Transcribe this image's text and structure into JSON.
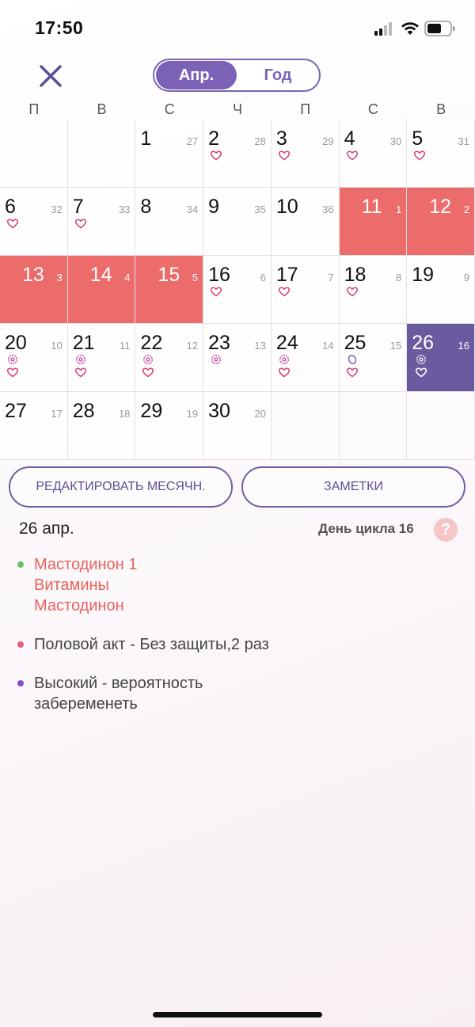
{
  "status": {
    "time": "17:50"
  },
  "header": {
    "close_icon": "close-icon",
    "segments": [
      {
        "label": "Апр.",
        "selected": true
      },
      {
        "label": "Год",
        "selected": false
      }
    ]
  },
  "weekdays": [
    "П",
    "В",
    "С",
    "Ч",
    "П",
    "С",
    "В"
  ],
  "calendar": {
    "rows": [
      [
        null,
        null,
        {
          "day": "1",
          "cycle": "27",
          "icons": []
        },
        {
          "day": "2",
          "cycle": "28",
          "icons": [
            "heart"
          ]
        },
        {
          "day": "3",
          "cycle": "29",
          "icons": [
            "heart"
          ]
        },
        {
          "day": "4",
          "cycle": "30",
          "icons": [
            "heart"
          ]
        },
        {
          "day": "5",
          "cycle": "31",
          "icons": [
            "heart"
          ]
        }
      ],
      [
        {
          "day": "6",
          "cycle": "32",
          "icons": [
            "heart"
          ]
        },
        {
          "day": "7",
          "cycle": "33",
          "icons": [
            "heart"
          ]
        },
        {
          "day": "8",
          "cycle": "34",
          "icons": []
        },
        {
          "day": "9",
          "cycle": "35",
          "icons": []
        },
        {
          "day": "10",
          "cycle": "36",
          "icons": []
        },
        {
          "day": "11",
          "cycle": "1",
          "icons": [],
          "period": true
        },
        {
          "day": "12",
          "cycle": "2",
          "icons": [],
          "period": true
        }
      ],
      [
        {
          "day": "13",
          "cycle": "3",
          "icons": [],
          "period": true
        },
        {
          "day": "14",
          "cycle": "4",
          "icons": [],
          "period": true
        },
        {
          "day": "15",
          "cycle": "5",
          "icons": [],
          "period": true
        },
        {
          "day": "16",
          "cycle": "6",
          "icons": [
            "heart"
          ]
        },
        {
          "day": "17",
          "cycle": "7",
          "icons": [
            "heart"
          ]
        },
        {
          "day": "18",
          "cycle": "8",
          "icons": [
            "heart"
          ]
        },
        {
          "day": "19",
          "cycle": "9",
          "icons": []
        }
      ],
      [
        {
          "day": "20",
          "cycle": "10",
          "icons": [
            "flower",
            "heart"
          ]
        },
        {
          "day": "21",
          "cycle": "11",
          "icons": [
            "flower",
            "heart"
          ]
        },
        {
          "day": "22",
          "cycle": "12",
          "icons": [
            "flower",
            "heart"
          ]
        },
        {
          "day": "23",
          "cycle": "13",
          "icons": [
            "flower"
          ]
        },
        {
          "day": "24",
          "cycle": "14",
          "icons": [
            "flower",
            "heart"
          ]
        },
        {
          "day": "25",
          "cycle": "15",
          "icons": [
            "egg",
            "heart"
          ]
        },
        {
          "day": "26",
          "cycle": "16",
          "icons": [
            "flower",
            "heart"
          ],
          "today": true
        }
      ],
      [
        {
          "day": "27",
          "cycle": "17",
          "icons": []
        },
        {
          "day": "28",
          "cycle": "18",
          "icons": []
        },
        {
          "day": "29",
          "cycle": "19",
          "icons": []
        },
        {
          "day": "30",
          "cycle": "20",
          "icons": []
        },
        null,
        null,
        null
      ]
    ]
  },
  "actions": {
    "edit_label": "РЕДАКТИРОВАТЬ МЕСЯЧН.",
    "notes_label": "ЗАМЕТКИ"
  },
  "detail": {
    "date": "26 апр.",
    "cycle_label": "День цикла 16",
    "help": "?",
    "entries": [
      {
        "color": "#6cc06a",
        "text_color": "#e8625e",
        "lines": [
          "Мастодинон 1",
          "Витамины",
          "Мастодинон"
        ]
      },
      {
        "color": "#e5607a",
        "text_color": "#444444",
        "lines": [
          "Половой акт - Без защиты,2 раз"
        ]
      },
      {
        "color": "#8a4fc8",
        "text_color": "#444444",
        "lines": [
          "Высокий - вероятность",
          "забеременеть"
        ]
      }
    ]
  },
  "colors": {
    "accent": "#7b62b6",
    "period": "#ec6b6b",
    "today": "#6b5aa0",
    "heart": "#d9467a",
    "flower": "#c2409a",
    "egg": "#7b62b6"
  }
}
